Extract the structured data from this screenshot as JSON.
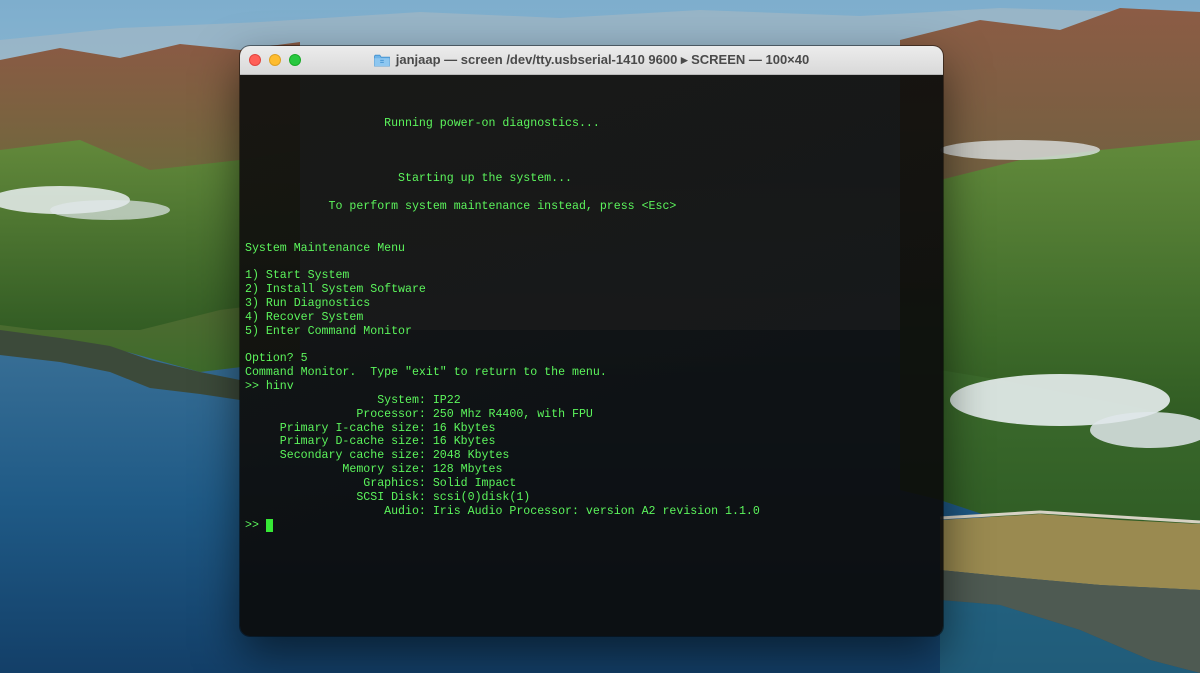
{
  "window": {
    "title": "janjaap — screen /dev/tty.usbserial-1410 9600 ▸ SCREEN — 100×40",
    "folder_icon": "folder-icon"
  },
  "colors": {
    "terminal_text": "#5cf55c",
    "terminal_bg": "#0c0c0c",
    "close": "#ff5f57",
    "minimize": "#febc2e",
    "zoom": "#28c840"
  },
  "terminal": {
    "lines": [
      "                    Running power-on diagnostics...",
      "",
      "",
      "",
      "                      Starting up the system...",
      "",
      "            To perform system maintenance instead, press <Esc>",
      "",
      "",
      "System Maintenance Menu",
      "",
      "1) Start System",
      "2) Install System Software",
      "3) Run Diagnostics",
      "4) Recover System",
      "5) Enter Command Monitor",
      "",
      "Option? 5",
      "Command Monitor.  Type \"exit\" to return to the menu.",
      ">> hinv",
      "                   System: IP22",
      "                Processor: 250 Mhz R4400, with FPU",
      "     Primary I-cache size: 16 Kbytes",
      "     Primary D-cache size: 16 Kbytes",
      "     Secondary cache size: 2048 Kbytes",
      "              Memory size: 128 Mbytes",
      "                 Graphics: Solid Impact",
      "                SCSI Disk: scsi(0)disk(1)",
      "                    Audio: Iris Audio Processor: version A2 revision 1.1.0"
    ],
    "prompt": ">>"
  }
}
